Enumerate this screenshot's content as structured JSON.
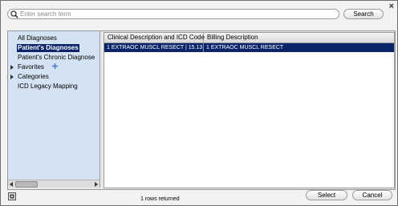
{
  "window": {
    "close_label": "×"
  },
  "search": {
    "placeholder": "Enter search term",
    "value": "",
    "button_label": "Search"
  },
  "tree": {
    "items": [
      {
        "label": "All Diagnoses",
        "selected": false,
        "expander": false
      },
      {
        "label": "Patient's Diagnoses",
        "selected": true,
        "expander": false
      },
      {
        "label": "Patient's Chronic Diagnose",
        "selected": false,
        "expander": false
      },
      {
        "label": "Favorites",
        "selected": false,
        "expander": true
      },
      {
        "label": "Categories",
        "selected": false,
        "expander": true
      },
      {
        "label": "ICD Legacy Mapping",
        "selected": false,
        "expander": false
      }
    ]
  },
  "grid": {
    "columns": [
      "Clinical Description and ICD Code",
      "Billing Description"
    ],
    "rows": [
      [
        "1 EXTRAOC MUSCL RESECT  |  15.13",
        "1 EXTRAOC MUSCL RESECT"
      ]
    ]
  },
  "status": {
    "rows_returned": "1 rows returned"
  },
  "footer": {
    "select_label": "Select",
    "cancel_label": "Cancel"
  },
  "colors": {
    "selection": "#0a246a",
    "tree_bg": "#d4e3f3",
    "dialog_bg": "#f2f2f2"
  },
  "icons": [
    "search-icon",
    "close-icon",
    "add-favorite-icon",
    "expand-arrow-icon",
    "settings-icon"
  ]
}
